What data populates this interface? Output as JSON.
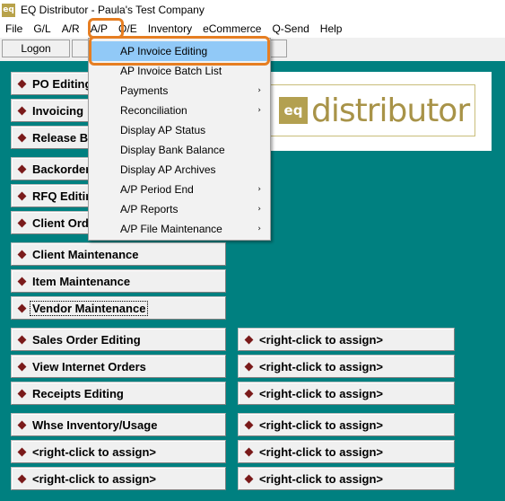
{
  "window": {
    "title": "EQ Distributor - Paula's Test Company",
    "app_icon_text": "eq"
  },
  "menubar": [
    "File",
    "G/L",
    "A/R",
    "A/P",
    "O/E",
    "Inventory",
    "eCommerce",
    "Q-Send",
    "Help"
  ],
  "toolbar": {
    "logon_label": "Logon"
  },
  "logo": {
    "mark": "eq",
    "wordmark": "distributor"
  },
  "ap_menu": {
    "items": [
      {
        "label": "AP Invoice Editing",
        "submenu": false,
        "selected": true
      },
      {
        "label": "AP Invoice Batch List",
        "submenu": false
      },
      {
        "label": "Payments",
        "submenu": true
      },
      {
        "label": "Reconciliation",
        "submenu": true
      },
      {
        "label": "Display AP Status",
        "submenu": false
      },
      {
        "label": "Display Bank Balance",
        "submenu": false
      },
      {
        "label": "Display AP Archives",
        "submenu": false
      },
      {
        "label": "A/P Period End",
        "submenu": true
      },
      {
        "label": "A/P Reports",
        "submenu": true
      },
      {
        "label": "A/P File Maintenance",
        "submenu": true
      }
    ],
    "arrow_glyph": "›"
  },
  "left_buttons": [
    "PO Editing",
    "Invoicing",
    "Release Batch",
    "Backorders",
    "RFQ Editing",
    "Client Orders",
    "Client Maintenance",
    "Item Maintenance",
    "Vendor Maintenance",
    "Sales Order Editing",
    "View Internet Orders",
    "Receipts Editing",
    "Whse Inventory/Usage",
    "<right-click to assign>",
    "<right-click to assign>"
  ],
  "right_buttons": [
    "<right-click to assign>",
    "<right-click to assign>",
    "<right-click to assign>",
    "<right-click to assign>",
    "<right-click to assign>",
    "<right-click to assign>"
  ],
  "colors": {
    "background": "#008080",
    "highlight_ring": "#e67e22",
    "menu_selection": "#91c9f7",
    "diamond": "#7a1a1a"
  }
}
